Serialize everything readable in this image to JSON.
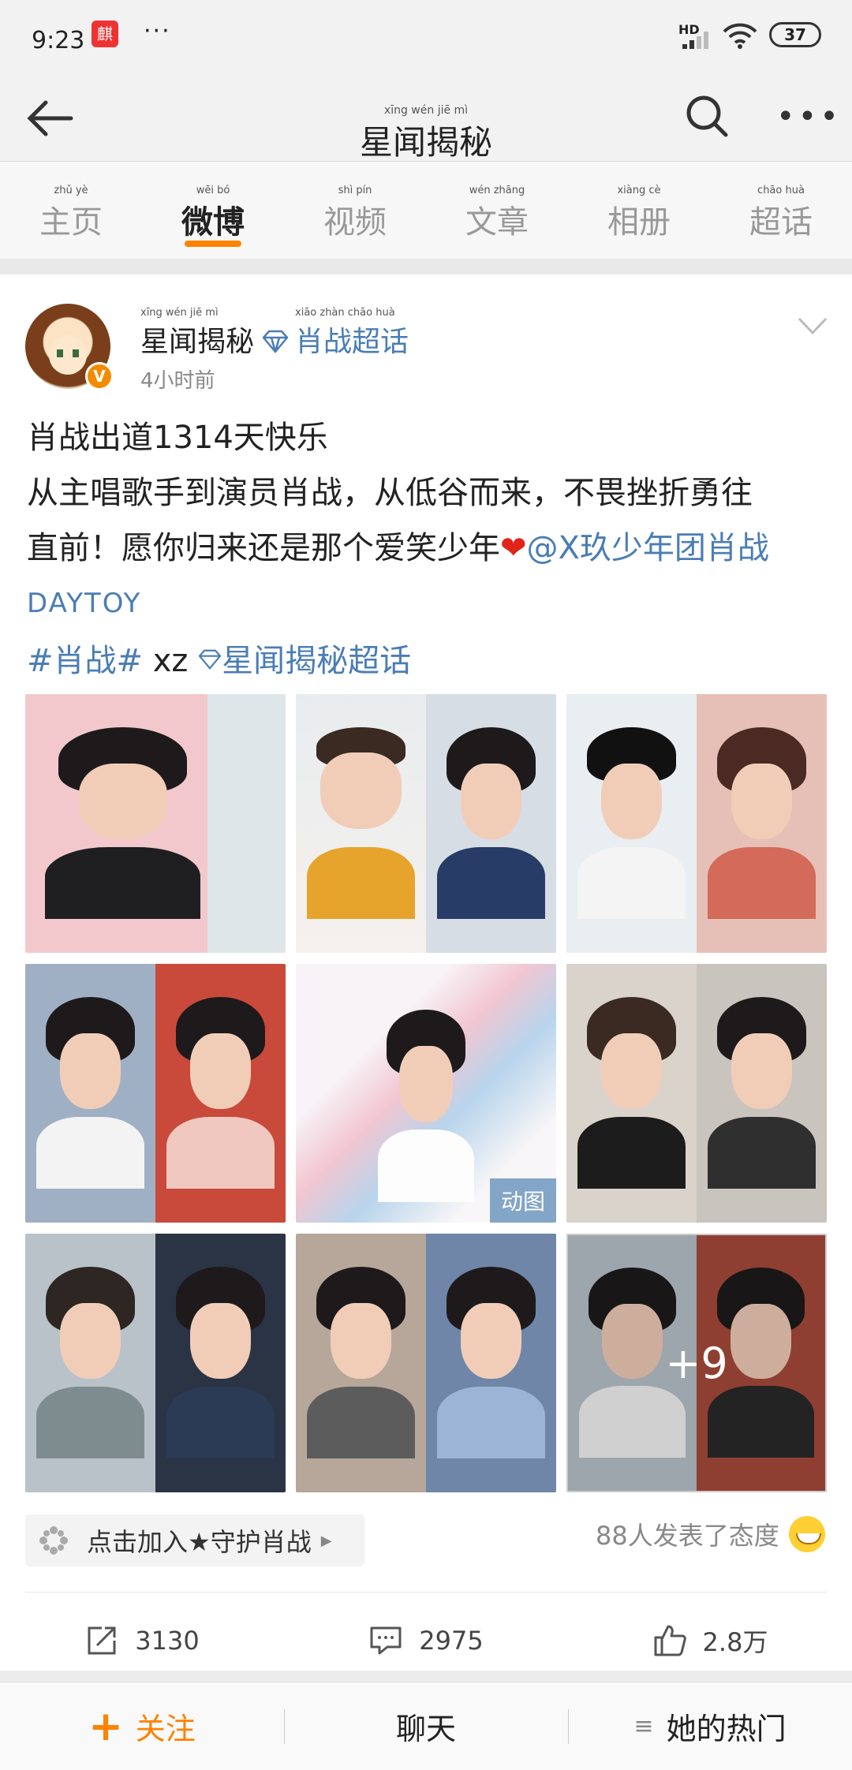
{
  "status": {
    "time": "9:23",
    "battery": "37",
    "hd": "HD"
  },
  "navbar": {
    "title": "星闻揭秘",
    "title_pinyin": "xīng wén jiē mì"
  },
  "tabs": [
    {
      "label": "主页",
      "pinyin": "zhǔ yè"
    },
    {
      "label": "微博",
      "pinyin": "wēi bó"
    },
    {
      "label": "视频",
      "pinyin": "shì pín"
    },
    {
      "label": "文章",
      "pinyin": "wén zhāng"
    },
    {
      "label": "相册",
      "pinyin": "xiàng cè"
    },
    {
      "label": "超话",
      "pinyin": "chāo huà"
    }
  ],
  "post": {
    "author": "星闻揭秘",
    "author_pinyin": "xīng wén jiē mì",
    "supertopic": "肖战超话",
    "supertopic_pinyin": "xiāo zhàn chāo huà",
    "time": "4小时前",
    "text_line1": "肖战出道1314天快乐",
    "text_line2": "从主唱歌手到演员肖战，从低谷而来，不畏挫折勇往",
    "text_line3_a": "直前！愿你归来还是那个爱笑少年",
    "heart": "❤",
    "mention": "@X玖少年团肖战",
    "mention_cont": "DAYTOY",
    "hashtag": "#肖战#",
    "extra": " xz ",
    "topic_link": "星闻揭秘超话",
    "gif_label": "动图",
    "more_images": "+9",
    "join": "点击加入★守护肖战",
    "attitude": "88人发表了态度"
  },
  "actions": {
    "repost": "3130",
    "comment": "2975",
    "like": "2.8万"
  },
  "bottombar": {
    "follow": "关注",
    "chat": "聊天",
    "hot": "她的热门"
  }
}
